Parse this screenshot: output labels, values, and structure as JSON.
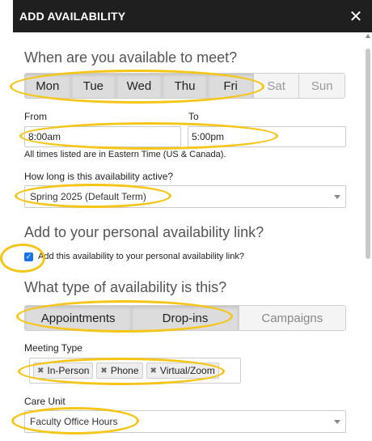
{
  "header": {
    "title": "ADD AVAILABILITY",
    "close_icon": "close-icon"
  },
  "sections": {
    "meet_heading": "When are you available to meet?",
    "link_heading": "Add to your personal availability link?",
    "type_heading": "What type of availability is this?"
  },
  "days": [
    {
      "label": "Mon",
      "selected": true
    },
    {
      "label": "Tue",
      "selected": true
    },
    {
      "label": "Wed",
      "selected": true
    },
    {
      "label": "Thu",
      "selected": true
    },
    {
      "label": "Fri",
      "selected": true
    },
    {
      "label": "Sat",
      "selected": false
    },
    {
      "label": "Sun",
      "selected": false
    }
  ],
  "time": {
    "from_label": "From",
    "from_value": "8:00am",
    "to_label": "To",
    "to_value": "5:00pm",
    "timezone_note": "All times listed are in Eastern Time (US & Canada)."
  },
  "active": {
    "label": "How long is this availability active?",
    "value": "Spring 2025 (Default Term)"
  },
  "personal_link": {
    "checked": true,
    "label": "Add this availability to your personal availability link?"
  },
  "types": [
    {
      "label": "Appointments",
      "selected": true
    },
    {
      "label": "Drop-ins",
      "selected": true
    },
    {
      "label": "Campaigns",
      "selected": false
    }
  ],
  "meeting_type": {
    "label": "Meeting Type",
    "tags": [
      "In-Person",
      "Phone",
      "Virtual/Zoom"
    ]
  },
  "care_unit": {
    "label": "Care Unit",
    "value": "Faculty Office Hours"
  },
  "colors": {
    "highlight": "#f5c518",
    "header_bg": "#1f1f1f",
    "checkbox": "#1a73e8"
  }
}
